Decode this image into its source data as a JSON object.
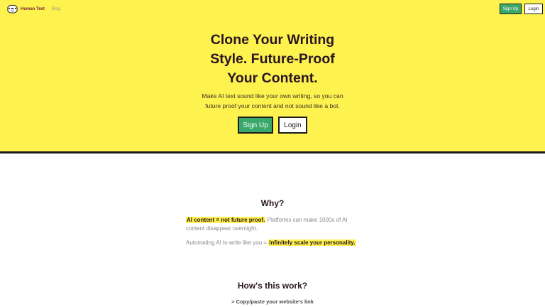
{
  "nav": {
    "logo_text": "Human Text",
    "logo_icon": "blob-face-icon",
    "blog_label": "Blog",
    "signup_label": "Sign Up",
    "login_label": "Login"
  },
  "hero": {
    "title": "Clone Your Writing\nStyle. Future-Proof\nYour Content.",
    "subtitle": "Make AI text sound like your own writing, so you can\nfuture proof your content and not sound like a bot.",
    "signup_label": "Sign Up",
    "login_label": "Login"
  },
  "why": {
    "title": "Why?",
    "p1_highlight": "AI content = not future proof.",
    "p1_text": " Platforms can make 1000s of AI content disappear overnight.",
    "p2_text": "Automating AI to write like you = ",
    "p2_highlight": "infinitely scale your personality."
  },
  "how": {
    "title": "How's this work?",
    "step1": "> Copy/paste your website's link"
  },
  "colors": {
    "hero_bg": "#fef24f",
    "accent_green": "#3aa86b",
    "dark_text": "#2a1622",
    "border": "#1c1c1c",
    "logo_text": "#7a1f36"
  }
}
